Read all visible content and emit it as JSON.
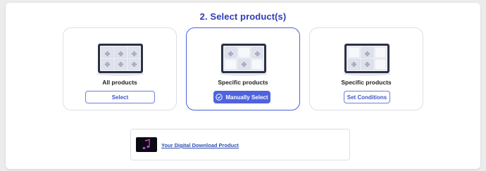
{
  "section": {
    "title": "2. Select product(s)"
  },
  "options": [
    {
      "title": "All products",
      "button_label": "Select",
      "selected": false
    },
    {
      "title": "Specific products",
      "button_label": "Manually Select",
      "selected": true
    },
    {
      "title": "Specific products",
      "button_label": "Set Conditions",
      "selected": false
    }
  ],
  "product": {
    "name": "Your Digital Download Product",
    "thumbnail_icon": "music-note-icon"
  },
  "colors": {
    "accent": "#4f63de",
    "heading": "#2f3bb5",
    "link": "#2d4fb0"
  }
}
